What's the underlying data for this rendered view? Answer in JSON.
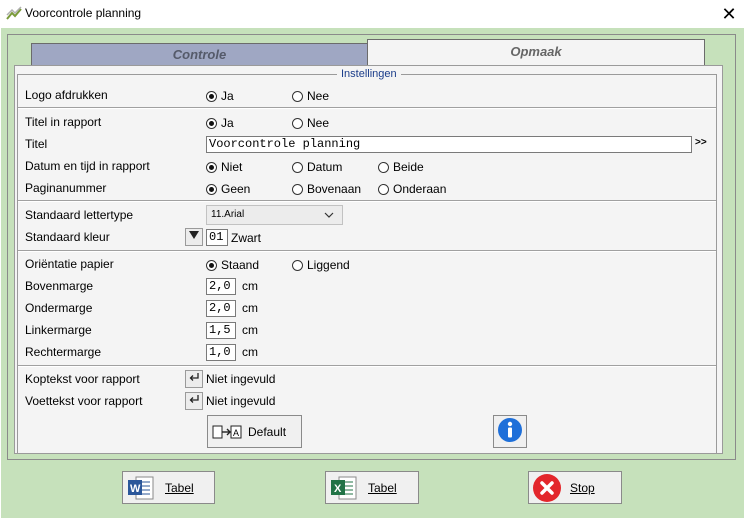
{
  "window": {
    "title": "Voorcontrole planning",
    "close_glyph": "✕"
  },
  "tabs": [
    {
      "label": "Controle",
      "active": false
    },
    {
      "label": "Opmaak",
      "active": true
    }
  ],
  "group": {
    "legend": "Instellingen"
  },
  "logo": {
    "label": "Logo afdrukken",
    "options": [
      "Ja",
      "Nee"
    ],
    "selected": 0
  },
  "titel_in_rapport": {
    "label": "Titel in rapport",
    "options": [
      "Ja",
      "Nee"
    ],
    "selected": 0
  },
  "titel": {
    "label": "Titel",
    "value": "Voorcontrole planning",
    "more": ">>"
  },
  "datum": {
    "label": "Datum en tijd in rapport",
    "options": [
      "Niet",
      "Datum",
      "Beide"
    ],
    "selected": 0
  },
  "paginanummer": {
    "label": "Paginanummer",
    "options": [
      "Geen",
      "Bovenaan",
      "Onderaan"
    ],
    "selected": 0
  },
  "lettertype": {
    "label": "Standaard lettertype",
    "value": "11.Arial"
  },
  "kleur": {
    "label": "Standaard kleur",
    "code": "01",
    "name": "Zwart"
  },
  "orientatie": {
    "label": "Oriëntatie papier",
    "options": [
      "Staand",
      "Liggend"
    ],
    "selected": 0
  },
  "marges": [
    {
      "label": "Bovenmarge",
      "value": "2,0",
      "unit": "cm"
    },
    {
      "label": "Ondermarge",
      "value": "2,0",
      "unit": "cm"
    },
    {
      "label": "Linkermarge",
      "value": "1,5",
      "unit": "cm"
    },
    {
      "label": "Rechtermarge",
      "value": "1,0",
      "unit": "cm"
    }
  ],
  "koptekst": {
    "label": "Koptekst voor rapport",
    "status": "Niet ingevuld"
  },
  "voettekst": {
    "label": "Voettekst voor rapport",
    "status": "Niet ingevuld"
  },
  "default_btn": {
    "label": "Default"
  },
  "footer": {
    "word_label": "Tabel",
    "excel_label": "Tabel",
    "stop_label": "Stop"
  },
  "colors": {
    "background": "#c6e1bb",
    "panel": "#f4f4f4",
    "tab_inactive": "#9fa7c3",
    "stop_red": "#e3262b",
    "word_blue": "#2b579a",
    "excel_green": "#217346",
    "info_blue": "#1e6fd9"
  },
  "icons": [
    "app-logo-icon",
    "close-icon",
    "chevron-down-icon",
    "color-dropdown-icon",
    "enter-icon",
    "default-reset-icon",
    "info-icon",
    "word-icon",
    "excel-icon",
    "stop-icon"
  ]
}
